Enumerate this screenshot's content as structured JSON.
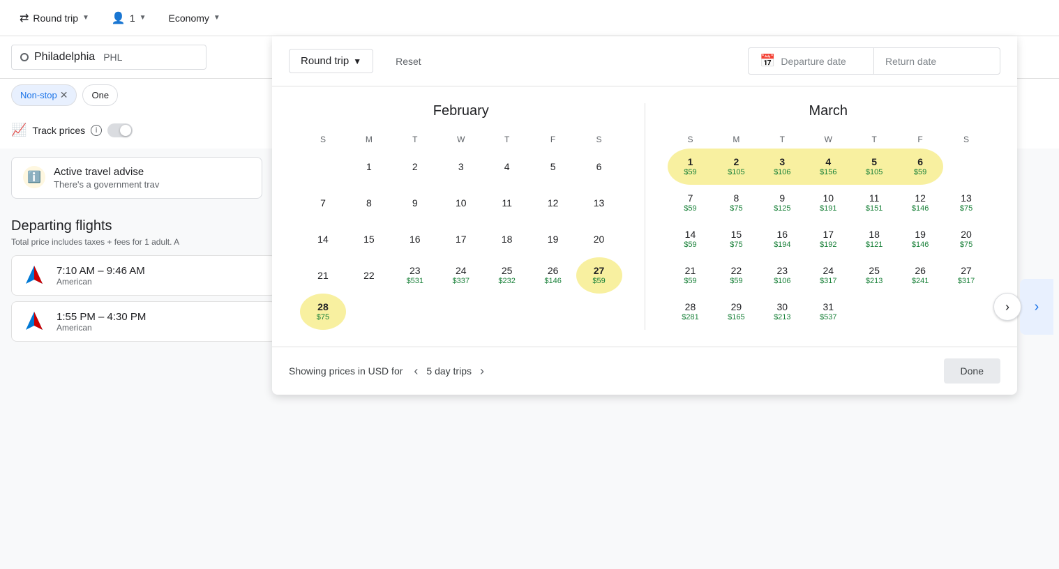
{
  "topbar": {
    "round_trip_label": "Round trip",
    "passengers": "1",
    "cabin_class": "Economy"
  },
  "search": {
    "origin_city": "Philadelphia",
    "origin_code": "PHL"
  },
  "filters": {
    "non_stop_label": "Non-stop",
    "one_label": "One"
  },
  "track_prices": {
    "label": "Track prices"
  },
  "advisory": {
    "title": "Active travel advise",
    "subtitle": "There's a government trav"
  },
  "departing": {
    "title": "Departing flights",
    "subtitle": "Total price includes taxes + fees for 1 adult. A",
    "flights": [
      {
        "time": "7:10 AM – 9:46 AM",
        "airline": "American"
      },
      {
        "time": "1:55 PM – 4:30 PM",
        "airline": "American"
      }
    ]
  },
  "calendar": {
    "trip_type": "Round trip",
    "reset_label": "Reset",
    "departure_placeholder": "Departure date",
    "return_placeholder": "Return date",
    "february": {
      "title": "February",
      "days_of_week": [
        "S",
        "M",
        "T",
        "W",
        "T",
        "F",
        "S"
      ],
      "weeks": [
        [
          {
            "day": "",
            "price": "",
            "empty": true
          },
          {
            "day": "1",
            "price": ""
          },
          {
            "day": "2",
            "price": ""
          },
          {
            "day": "3",
            "price": ""
          },
          {
            "day": "4",
            "price": ""
          },
          {
            "day": "5",
            "price": ""
          },
          {
            "day": "6",
            "price": ""
          }
        ],
        [
          {
            "day": "7",
            "price": ""
          },
          {
            "day": "8",
            "price": ""
          },
          {
            "day": "9",
            "price": ""
          },
          {
            "day": "10",
            "price": ""
          },
          {
            "day": "11",
            "price": ""
          },
          {
            "day": "12",
            "price": ""
          },
          {
            "day": "13",
            "price": ""
          }
        ],
        [
          {
            "day": "14",
            "price": ""
          },
          {
            "day": "15",
            "price": ""
          },
          {
            "day": "16",
            "price": ""
          },
          {
            "day": "17",
            "price": ""
          },
          {
            "day": "18",
            "price": ""
          },
          {
            "day": "19",
            "price": ""
          },
          {
            "day": "20",
            "price": ""
          }
        ],
        [
          {
            "day": "21",
            "price": ""
          },
          {
            "day": "22",
            "price": ""
          },
          {
            "day": "23",
            "price": "$531"
          },
          {
            "day": "24",
            "price": "$337"
          },
          {
            "day": "25",
            "price": "$232"
          },
          {
            "day": "26",
            "price": "$146"
          },
          {
            "day": "27",
            "price": "$59",
            "highlighted": true
          }
        ],
        [
          {
            "day": "28",
            "price": "$75",
            "highlighted": true
          },
          {
            "day": "",
            "price": "",
            "empty": true
          },
          {
            "day": "",
            "price": "",
            "empty": true
          },
          {
            "day": "",
            "price": "",
            "empty": true
          },
          {
            "day": "",
            "price": "",
            "empty": true
          },
          {
            "day": "",
            "price": "",
            "empty": true
          },
          {
            "day": "",
            "price": "",
            "empty": true
          }
        ]
      ]
    },
    "march": {
      "title": "March",
      "days_of_week": [
        "S",
        "M",
        "T",
        "W",
        "T",
        "F",
        "S"
      ],
      "weeks": [
        [
          {
            "day": "1",
            "price": "$59",
            "range": "start"
          },
          {
            "day": "2",
            "price": "$105",
            "range": "middle"
          },
          {
            "day": "3",
            "price": "$106",
            "range": "middle"
          },
          {
            "day": "4",
            "price": "$156",
            "range": "middle"
          },
          {
            "day": "5",
            "price": "$105",
            "range": "middle"
          },
          {
            "day": "6",
            "price": "$59",
            "range": "end"
          },
          {
            "day": "",
            "price": "",
            "empty": true
          }
        ],
        [
          {
            "day": "7",
            "price": "$59"
          },
          {
            "day": "8",
            "price": "$75"
          },
          {
            "day": "9",
            "price": "$125"
          },
          {
            "day": "10",
            "price": "$191"
          },
          {
            "day": "11",
            "price": "$151"
          },
          {
            "day": "12",
            "price": "$146"
          },
          {
            "day": "13",
            "price": "$75"
          }
        ],
        [
          {
            "day": "14",
            "price": "$59"
          },
          {
            "day": "15",
            "price": "$75"
          },
          {
            "day": "16",
            "price": "$194"
          },
          {
            "day": "17",
            "price": "$192"
          },
          {
            "day": "18",
            "price": "$121"
          },
          {
            "day": "19",
            "price": "$146"
          },
          {
            "day": "20",
            "price": "$75"
          }
        ],
        [
          {
            "day": "21",
            "price": "$59"
          },
          {
            "day": "22",
            "price": "$59"
          },
          {
            "day": "23",
            "price": "$106"
          },
          {
            "day": "24",
            "price": "$317"
          },
          {
            "day": "25",
            "price": "$213"
          },
          {
            "day": "26",
            "price": "$241"
          },
          {
            "day": "27",
            "price": "$317"
          }
        ],
        [
          {
            "day": "28",
            "price": "$281"
          },
          {
            "day": "29",
            "price": "$165"
          },
          {
            "day": "30",
            "price": "$213"
          },
          {
            "day": "31",
            "price": "$537"
          },
          {
            "day": "",
            "price": "",
            "empty": true
          },
          {
            "day": "",
            "price": "",
            "empty": true
          },
          {
            "day": "",
            "price": "",
            "empty": true
          }
        ]
      ]
    },
    "footer": {
      "showing_text": "Showing prices in USD for",
      "day_trips": "5 day trips",
      "done_label": "Done"
    }
  }
}
